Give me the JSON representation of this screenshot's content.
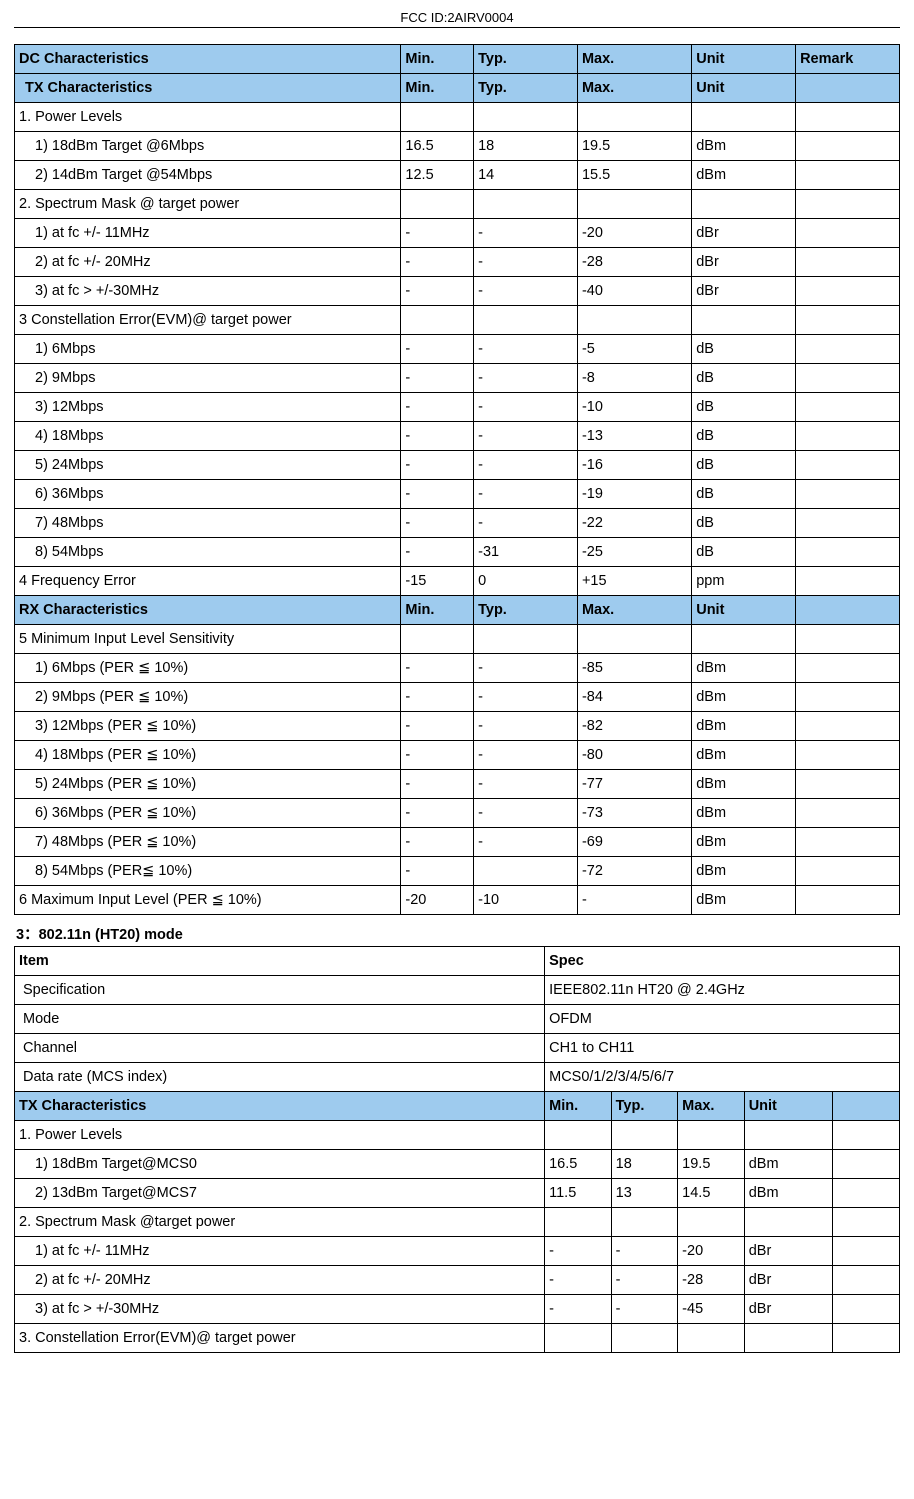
{
  "header": {
    "fcc": "FCC ID:2AIRV0004"
  },
  "t1": {
    "h1": {
      "a": "DC Characteristics",
      "min": "Min.",
      "typ": "Typ.",
      "max": "Max.",
      "unit": "Unit",
      "rem": "Remark"
    },
    "h2": {
      "a": "  TX Characteristics",
      "min": "Min.",
      "typ": "Typ.",
      "max": "Max.",
      "unit": "Unit"
    },
    "r": [
      {
        "a": "1. Power Levels",
        "min": "",
        "typ": "",
        "max": "",
        "unit": "",
        "rem": ""
      },
      {
        "a": "1) 18dBm Target @6Mbps",
        "min": "16.5",
        "typ": "18",
        "max": "19.5",
        "unit": "dBm",
        "rem": "",
        "sub": 1
      },
      {
        "a": "2) 14dBm Target @54Mbps",
        "min": "12.5",
        "typ": "14",
        "max": "15.5",
        "unit": "dBm",
        "rem": "",
        "sub": 1
      },
      {
        "a": "2. Spectrum Mask @ target power",
        "min": "",
        "typ": "",
        "max": "",
        "unit": "",
        "rem": ""
      },
      {
        "a": "1) at fc +/- 11MHz",
        "min": "-",
        "typ": "-",
        "max": "-20",
        "unit": "dBr",
        "rem": "",
        "sub": 1
      },
      {
        "a": "2) at fc +/- 20MHz",
        "min": "-",
        "typ": "-",
        "max": "-28",
        "unit": "dBr",
        "rem": "",
        "sub": 1
      },
      {
        "a": "3) at fc > +/-30MHz",
        "min": "-",
        "typ": "-",
        "max": "-40",
        "unit": "dBr",
        "rem": "",
        "sub": 1
      },
      {
        "a": "3 Constellation Error(EVM)@ target power",
        "min": "",
        "typ": "",
        "max": "",
        "unit": "",
        "rem": ""
      },
      {
        "a": "1) 6Mbps",
        "min": "-",
        "typ": "-",
        "max": "-5",
        "unit": "dB",
        "rem": "",
        "sub": 1
      },
      {
        "a": "2) 9Mbps",
        "min": "-",
        "typ": "-",
        "max": "-8",
        "unit": "dB",
        "rem": "",
        "sub": 1
      },
      {
        "a": "3) 12Mbps",
        "min": "-",
        "typ": "-",
        "max": "-10",
        "unit": "dB",
        "rem": "",
        "sub": 1
      },
      {
        "a": "4) 18Mbps",
        "min": "-",
        "typ": "-",
        "max": "-13",
        "unit": "dB",
        "rem": "",
        "sub": 1
      },
      {
        "a": "5) 24Mbps",
        "min": "-",
        "typ": "-",
        "max": "-16",
        "unit": "dB",
        "rem": "",
        "sub": 1
      },
      {
        "a": "6) 36Mbps",
        "min": "-",
        "typ": "-",
        "max": "-19",
        "unit": "dB",
        "rem": "",
        "sub": 1
      },
      {
        "a": "7) 48Mbps",
        "min": "-",
        "typ": "-",
        "max": "-22",
        "unit": "dB",
        "rem": "",
        "sub": 1
      },
      {
        "a": "8) 54Mbps",
        "min": "-",
        "typ": "-31",
        "max": "-25",
        "unit": "dB",
        "rem": "",
        "sub": 1
      },
      {
        "a": "4 Frequency Error",
        "min": "-15",
        "typ": "0",
        "max": "+15",
        "unit": "ppm",
        "rem": ""
      }
    ],
    "h3": {
      "a": "RX Characteristics",
      "min": "Min.",
      "typ": "Typ.",
      "max": "Max.",
      "unit": "Unit"
    },
    "r2": [
      {
        "a": "5 Minimum Input Level Sensitivity",
        "min": "",
        "typ": "",
        "max": "",
        "unit": "",
        "rem": ""
      },
      {
        "a": "1) 6Mbps (PER ≦ 10%)",
        "min": "-",
        "typ": "-",
        "max": "-85",
        "unit": "dBm",
        "rem": "",
        "sub": 1
      },
      {
        "a": "2) 9Mbps (PER ≦ 10%)",
        "min": "-",
        "typ": "-",
        "max": "-84",
        "unit": "dBm",
        "rem": "",
        "sub": 1
      },
      {
        "a": "3) 12Mbps (PER ≦ 10%)",
        "min": "-",
        "typ": "-",
        "max": "-82",
        "unit": "dBm",
        "rem": "",
        "sub": 1
      },
      {
        "a": "4) 18Mbps (PER ≦ 10%)",
        "min": "-",
        "typ": "-",
        "max": "-80",
        "unit": "dBm",
        "rem": "",
        "sub": 1
      },
      {
        "a": "5) 24Mbps (PER ≦ 10%)",
        "min": "-",
        "typ": "-",
        "max": "-77",
        "unit": "dBm",
        "rem": "",
        "sub": 1
      },
      {
        "a": "6) 36Mbps (PER ≦ 10%)",
        "min": "-",
        "typ": "-",
        "max": "-73",
        "unit": "dBm",
        "rem": "",
        "sub": 1
      },
      {
        "a": "7) 48Mbps (PER ≦ 10%)",
        "min": "-",
        "typ": "-",
        "max": "-69",
        "unit": "dBm",
        "rem": "",
        "sub": 1
      },
      {
        "a": "8) 54Mbps (PER≦ 10%)",
        "min": "-",
        "typ": "",
        "max": "-72",
        "unit": "dBm",
        "rem": "",
        "sub": 1
      },
      {
        "a": "6 Maximum Input Level (PER ≦ 10%)",
        "min": "-20",
        "typ": "-10",
        "max": "-",
        "unit": "dBm",
        "rem": ""
      }
    ]
  },
  "sec2": {
    "title": "3：802.11n (HT20) mode",
    "info": {
      "h": {
        "item": "Item",
        "spec": "Spec"
      },
      "rows": [
        {
          "a": " Specification",
          "b": "IEEE802.11n HT20 @ 2.4GHz"
        },
        {
          "a": " Mode",
          "b": "OFDM"
        },
        {
          "a": " Channel",
          "b": "CH1 to CH11"
        },
        {
          "a": " Data rate (MCS index)",
          "b": "MCS0/1/2/3/4/5/6/7"
        }
      ]
    },
    "tx": {
      "h": {
        "a": "TX Characteristics",
        "min": "Min.",
        "typ": "Typ.",
        "max": "Max.",
        "unit": "Unit"
      },
      "r": [
        {
          "a": "1. Power Levels",
          "min": "",
          "typ": "",
          "max": "",
          "unit": "",
          "rem": ""
        },
        {
          "a": "1) 18dBm Target@MCS0",
          "min": "16.5",
          "typ": "18",
          "max": "19.5",
          "unit": "dBm",
          "rem": "",
          "sub": 1
        },
        {
          "a": "2) 13dBm Target@MCS7",
          "min": "11.5",
          "typ": "13",
          "max": "14.5",
          "unit": "dBm",
          "rem": "",
          "sub": 1
        },
        {
          "a": "2. Spectrum Mask @target power",
          "min": "",
          "typ": "",
          "max": "",
          "unit": "",
          "rem": ""
        },
        {
          "a": "1) at fc +/- 11MHz",
          "min": "-",
          "typ": "-",
          "max": "-20",
          "unit": "dBr",
          "rem": "",
          "sub": 1
        },
        {
          "a": "2) at fc +/- 20MHz",
          "min": "-",
          "typ": "-",
          "max": "-28",
          "unit": "dBr",
          "rem": "",
          "sub": 1
        },
        {
          "a": "3) at fc > +/-30MHz",
          "min": "-",
          "typ": "-",
          "max": "-45",
          "unit": "dBr",
          "rem": "",
          "sub": 1
        },
        {
          "a": "3. Constellation Error(EVM)@ target power",
          "min": "",
          "typ": "",
          "max": "",
          "unit": "",
          "rem": ""
        }
      ]
    }
  }
}
